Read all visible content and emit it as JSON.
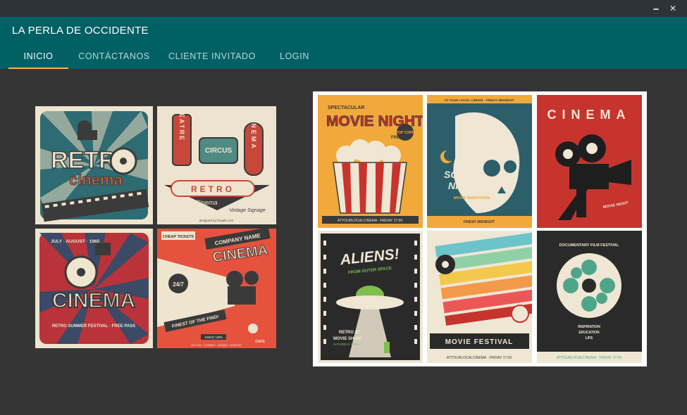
{
  "window": {
    "minimize_icon": "minimize-icon",
    "close_icon": "close-icon",
    "minimize_glyph": "🗕",
    "close_glyph": "✕"
  },
  "app": {
    "title": "LA PERLA DE OCCIDENTE"
  },
  "tabs": [
    {
      "label": "INICIO",
      "active": true
    },
    {
      "label": "CONTÁCTANOS",
      "active": false
    },
    {
      "label": "CLIENTE INVITADO",
      "active": false
    },
    {
      "label": "LOGIN",
      "active": false
    }
  ],
  "colors": {
    "appbar": "#006064",
    "titlebar": "#2d3338",
    "background": "#353535",
    "tab_indicator": "#ffb74d"
  },
  "left_posters": {
    "retro_cinema": {
      "line1": "RETRO",
      "line2": "cinema"
    },
    "signage": {
      "theatre": "THEATRE",
      "circus": "CIRCUS",
      "cinema": "CINEMA",
      "retro": "RETRO",
      "caption": "Cinema",
      "footer": "Vintage Signage",
      "credit": "designed by freepik.com"
    },
    "cinema_free": {
      "title": "CINEMA",
      "top": "JULY · AUGUST · 1965",
      "bottom": "RETRO SUMMER FESTIVAL · FREE PASS"
    },
    "company_cinema": {
      "tag": "CHEAP TICKETS",
      "company": "COMPANY NAME",
      "title": "CINEMA",
      "hours": "24/7",
      "slogan": "FINEST OF THE FIND!",
      "since": "SINCE 1905",
      "cafe": "CAFE",
      "genres": "ACTION · COMEDY · DRAMA · HORROR"
    }
  },
  "right_posters": {
    "movie_night": {
      "top": "SPECTACULAR",
      "title": "MOVIE NIGHT!",
      "badge": "POP CORN",
      "free": "FREE",
      "footer": "ATYOURLOCALCINEMA · FRIDAY 17:00"
    },
    "scary_night": {
      "top": "AT YOUR LOCAL CINEMA · FRIDAY MIDNIGHT",
      "title1": "SCARY",
      "title2": "NIGHT",
      "sub": "MOVIE MARATHON",
      "footer": "FRIDAY MIDNIGHT"
    },
    "cinema_red": {
      "title": "CINEMA",
      "sub": "MOVIE NIGHT"
    },
    "aliens": {
      "title": "ALIENS!",
      "sub": "FROM OUTER SPACE",
      "show1": "RETRO SF",
      "show2": "MOVIE SHOW",
      "date": "SATURDAY 19:00"
    },
    "festival": {
      "title": "MOVIE FESTIVAL",
      "footer": "ATYOURLOCALCINEMA · FRIDAY 17:00"
    },
    "documentary": {
      "top": "DOCUMENTARY FILM FESTIVAL",
      "l1": "INSPIRATION",
      "l2": "EDUCATION",
      "l3": "LIFE",
      "footer": "ATYOURLOCALCINEMA · FRIDAY 17:00"
    }
  }
}
